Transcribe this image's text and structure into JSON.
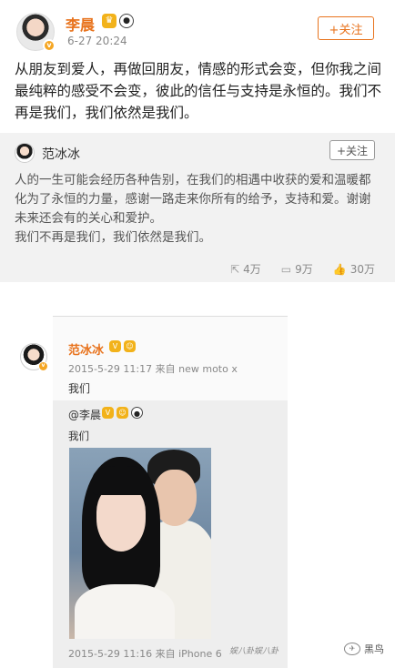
{
  "post1": {
    "author": "李晨",
    "badges": [
      "😵",
      "🐼"
    ],
    "time": "6-27 20:24",
    "follow_label": "+关注",
    "text": "从朋友到爱人，再做回朋友，情感的形式会变，但你我之间最纯粹的感受不会变，彼此的信任与支持是永恒的。我们不再是我们，我们依然是我们。",
    "repost": {
      "author": "范冰冰",
      "follow_label": "+关注",
      "text": "人的一生可能会经历各种告别，在我们的相遇中收获的爱和温暖都化为了永恒的力量，感谢一路走来你所有的给予，支持和爱。谢谢未来还会有的关心和爱护。\n我们不再是我们，我们依然是我们。",
      "stats": {
        "reposts": "4万",
        "comments": "9万",
        "likes": "30万"
      }
    }
  },
  "post2": {
    "author": "范冰冰",
    "meta": "2015-5-29 11:17 来自 new moto x",
    "text": "我们",
    "inner": {
      "mention": "@李晨",
      "text": "我们",
      "footer": "2015-5-29 11:16 来自 iPhone 6"
    }
  },
  "watermarks": {
    "left": "娱八卦娱八卦",
    "right": "黑鸟"
  },
  "colors": {
    "accent": "#e8731d",
    "repost_bg": "#f2f2f2"
  }
}
